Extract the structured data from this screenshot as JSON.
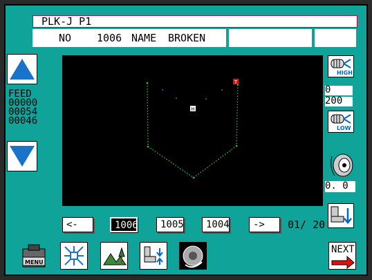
{
  "title": "PLK-J P1",
  "info": {
    "no_label": "NO",
    "no_value": "1006",
    "name_label": "NAME",
    "name_value": "BROKEN"
  },
  "feed": {
    "label": "FEED",
    "values": [
      "00000",
      "00054",
      "00046"
    ]
  },
  "speed": {
    "value": "0",
    "max": "200"
  },
  "tension": {
    "value": "0. 0"
  },
  "pattern_nav": {
    "prev_label": "<-",
    "items": [
      "1006",
      "1005",
      "1004"
    ],
    "selected": "1006",
    "next_label": "->",
    "page": "01/ 20"
  },
  "buttons": {
    "high": "HIGH",
    "low": "LOW",
    "menu": "MENU",
    "next": "NEXT"
  },
  "markers": {
    "start": "T",
    "home": "H"
  },
  "icons": [
    "up-arrow-icon",
    "down-arrow-icon",
    "speed-high-icon",
    "speed-low-icon",
    "thread-tension-icon",
    "pattern-move-icon",
    "menu-icon",
    "expand-icon",
    "landscape-icon",
    "clamp-icon",
    "wheel-icon",
    "next-icon"
  ],
  "colors": {
    "panel": "#0fa39a",
    "stitch": "#1ed14a",
    "accent_red": "#e01010",
    "nav_blue": "#1a73c8"
  }
}
